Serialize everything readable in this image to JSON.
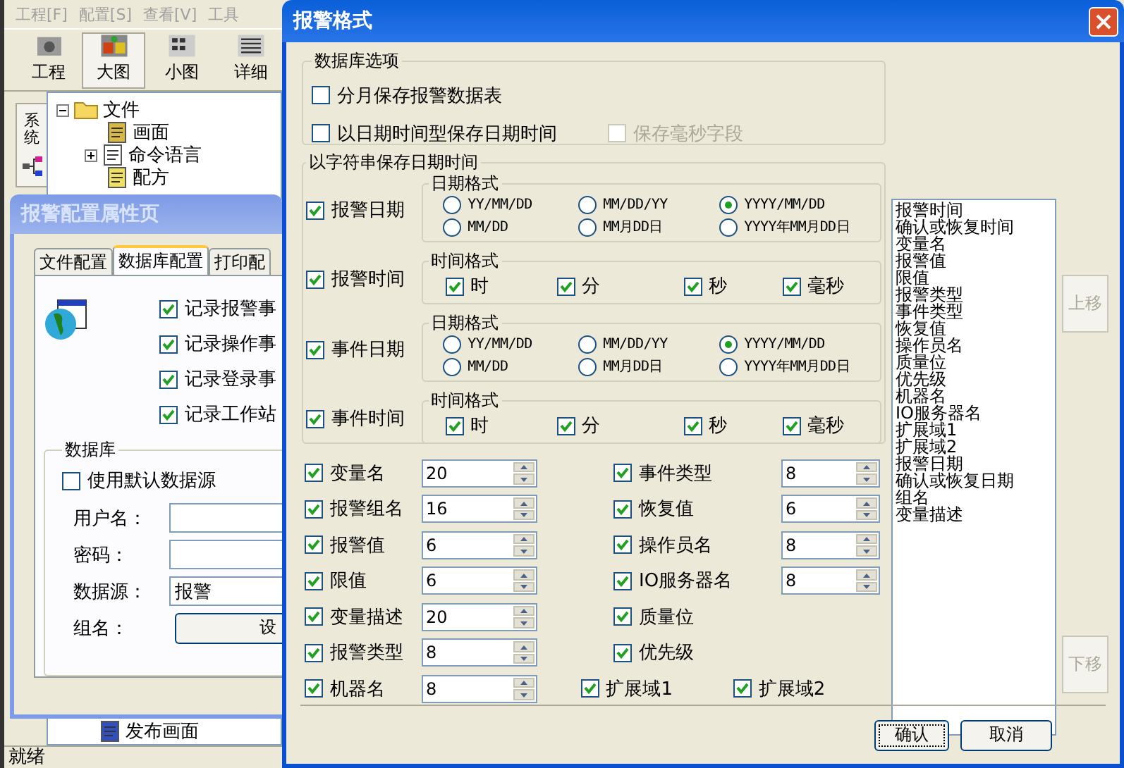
{
  "app_window": {
    "menu": [
      "工程[F]",
      "配置[S]",
      "查看[V]",
      "工具"
    ],
    "toolbar": [
      {
        "label": "工程",
        "selected": false
      },
      {
        "label": "大图",
        "selected": true
      },
      {
        "label": "小图",
        "selected": false
      },
      {
        "label": "详细",
        "selected": false
      }
    ],
    "side_tab": "系统",
    "tree": [
      {
        "label": "文件",
        "expanded": true,
        "children": [
          {
            "label": "画面"
          },
          {
            "label": "命令语言",
            "expanded": false
          },
          {
            "label": "配方"
          }
        ]
      }
    ],
    "tree_bottom": "发布画面",
    "status_bar": "就绪"
  },
  "property_dialog": {
    "title": "报警配置属性页",
    "tabs": [
      {
        "label": "文件配置",
        "selected": false
      },
      {
        "label": "数据库配置",
        "selected": true
      },
      {
        "label": "打印配",
        "selected": false
      }
    ],
    "records": [
      {
        "label": "记录报警事",
        "checked": true
      },
      {
        "label": "记录操作事",
        "checked": true
      },
      {
        "label": "记录登录事",
        "checked": true
      },
      {
        "label": "记录工作站",
        "checked": true
      }
    ],
    "database": {
      "title": "数据库",
      "use_default": {
        "label": "使用默认数据源",
        "checked": false
      },
      "fields": [
        {
          "label": "用户名："
        },
        {
          "label": "密码："
        },
        {
          "label": "数据源：",
          "value": "报警"
        }
      ],
      "group_label": "组名：",
      "group_button": "设"
    }
  },
  "dialog": {
    "title": "报警格式",
    "database_options": {
      "title": "数据库选项",
      "options": [
        {
          "label": "分月保存报警数据表",
          "checked": false,
          "disabled": false
        },
        {
          "label": "以日期时间型保存日期时间",
          "checked": false,
          "disabled": false
        },
        {
          "label": "保存毫秒字段",
          "checked": false,
          "disabled": true
        }
      ]
    },
    "string_section": {
      "title": "以字符串保存日期时间",
      "rows": [
        {
          "label": "报警日期",
          "checked": true,
          "kind": "date",
          "group_title": "日期格式",
          "options": [
            {
              "label": "YY/MM/DD",
              "selected": false
            },
            {
              "label": "MM/DD/YY",
              "selected": false
            },
            {
              "label": "YYYY/MM/DD",
              "selected": true
            },
            {
              "label": "MM/DD",
              "selected": false
            },
            {
              "label": "MM月DD日",
              "selected": false
            },
            {
              "label": "YYYY年MM月DD日",
              "selected": false
            }
          ]
        },
        {
          "label": "报警时间",
          "checked": true,
          "kind": "time",
          "group_title": "时间格式",
          "options": [
            {
              "label": "时",
              "checked": true
            },
            {
              "label": "分",
              "checked": true
            },
            {
              "label": "秒",
              "checked": true
            },
            {
              "label": "毫秒",
              "checked": true
            }
          ]
        },
        {
          "label": "事件日期",
          "checked": true,
          "kind": "date",
          "group_title": "日期格式",
          "options": [
            {
              "label": "YY/MM/DD",
              "selected": false
            },
            {
              "label": "MM/DD/YY",
              "selected": false
            },
            {
              "label": "YYYY/MM/DD",
              "selected": true
            },
            {
              "label": "MM/DD",
              "selected": false
            },
            {
              "label": "MM月DD日",
              "selected": false
            },
            {
              "label": "YYYY年MM月DD日",
              "selected": false
            }
          ]
        },
        {
          "label": "事件时间",
          "checked": true,
          "kind": "time",
          "group_title": "时间格式",
          "options": [
            {
              "label": "时",
              "checked": true
            },
            {
              "label": "分",
              "checked": true
            },
            {
              "label": "秒",
              "checked": true
            },
            {
              "label": "毫秒",
              "checked": true
            }
          ]
        }
      ]
    },
    "field_rows": [
      {
        "cells": [
          {
            "kind": "spin",
            "label": "变量名",
            "checked": true,
            "value": "20"
          },
          {
            "kind": "spin",
            "label": "事件类型",
            "checked": true,
            "value": "8"
          }
        ]
      },
      {
        "cells": [
          {
            "kind": "spin",
            "label": "报警组名",
            "checked": true,
            "value": "16"
          },
          {
            "kind": "spin",
            "label": "恢复值",
            "checked": true,
            "value": "6"
          }
        ]
      },
      {
        "cells": [
          {
            "kind": "spin",
            "label": "报警值",
            "checked": true,
            "value": "6"
          },
          {
            "kind": "spin",
            "label": "操作员名",
            "checked": true,
            "value": "8"
          }
        ]
      },
      {
        "cells": [
          {
            "kind": "spin",
            "label": "限值",
            "checked": true,
            "value": "6"
          },
          {
            "kind": "spin",
            "label": "IO服务器名",
            "checked": true,
            "value": "8"
          }
        ]
      },
      {
        "cells": [
          {
            "kind": "spin",
            "label": "变量描述",
            "checked": true,
            "value": "20"
          },
          {
            "kind": "check",
            "label": "质量位",
            "checked": true
          }
        ]
      },
      {
        "cells": [
          {
            "kind": "spin",
            "label": "报警类型",
            "checked": true,
            "value": "8"
          },
          {
            "kind": "check",
            "label": "优先级",
            "checked": true
          }
        ]
      },
      {
        "cells": [
          {
            "kind": "spin",
            "label": "机器名",
            "checked": true,
            "value": "8"
          },
          {
            "kind": "check",
            "label": "扩展域1",
            "checked": true
          },
          {
            "kind": "check",
            "label": "扩展域2",
            "checked": true
          }
        ]
      }
    ],
    "order_list": [
      "报警时间",
      "确认或恢复时间",
      "变量名",
      "报警值",
      "限值",
      "报警类型",
      "事件类型",
      "恢复值",
      "操作员名",
      "质量位",
      "优先级",
      "机器名",
      "IO服务器名",
      "扩展域1",
      "扩展域2",
      "报警日期",
      "确认或恢复日期",
      "组名",
      "变量描述"
    ],
    "move_up": {
      "label": "上移",
      "disabled": true
    },
    "move_down": {
      "label": "下移",
      "disabled": true
    },
    "buttons": [
      {
        "label": "确认",
        "focused": true
      },
      {
        "label": "取消",
        "focused": false
      }
    ]
  }
}
